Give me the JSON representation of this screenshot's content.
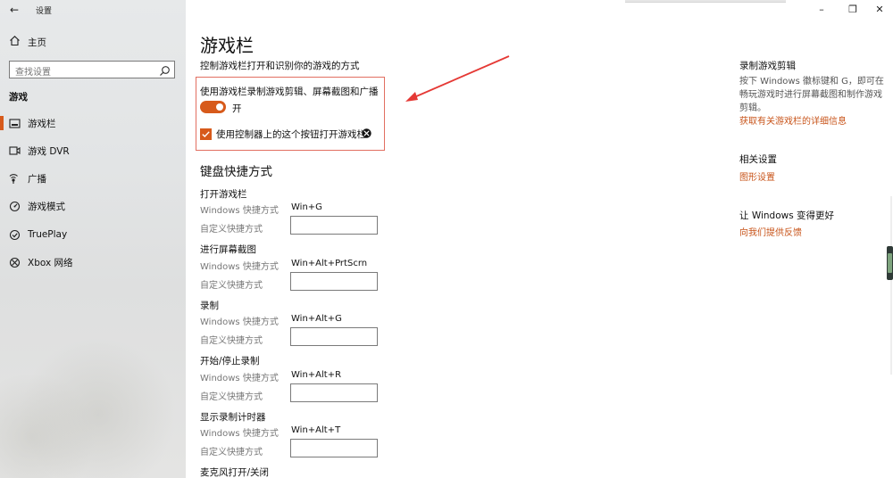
{
  "window": {
    "title": "设置",
    "back_icon": "back-arrow-icon",
    "controls": {
      "minimize": "–",
      "maximize": "❐",
      "close": "✕"
    }
  },
  "sidebar": {
    "home": {
      "label": "主页",
      "icon": "home-icon"
    },
    "search": {
      "placeholder": "查找设置",
      "icon": "search-icon"
    },
    "section": "游戏",
    "items": [
      {
        "label": "游戏栏",
        "icon": "game-bar-icon",
        "selected": true
      },
      {
        "label": "游戏 DVR",
        "icon": "dvr-icon",
        "selected": false
      },
      {
        "label": "广播",
        "icon": "broadcast-icon",
        "selected": false
      },
      {
        "label": "游戏模式",
        "icon": "game-mode-icon",
        "selected": false
      },
      {
        "label": "TruePlay",
        "icon": "trueplay-icon",
        "selected": false
      },
      {
        "label": "Xbox 网络",
        "icon": "xbox-icon",
        "selected": false
      }
    ],
    "accent": "#d75a1b"
  },
  "main": {
    "title": "游戏栏",
    "description": "控制游戏栏打开和识别你的游戏的方式",
    "record_option": {
      "label": "使用游戏栏录制游戏剪辑、屏幕截图和广播",
      "state": "开",
      "on": true
    },
    "controller_option": {
      "label": "使用控制器上的这个按钮打开游戏栏:",
      "checked": true,
      "icon": "xbox-logo-icon"
    },
    "keyboard_title": "键盘快捷方式",
    "windows_shortcut_label": "Windows 快捷方式",
    "custom_shortcut_label": "自定义快捷方式",
    "shortcuts": [
      {
        "action": "打开游戏栏",
        "windows": "Win+G",
        "custom": ""
      },
      {
        "action": "进行屏幕截图",
        "windows": "Win+Alt+PrtScrn",
        "custom": ""
      },
      {
        "action": "录制",
        "windows": "Win+Alt+G",
        "custom": ""
      },
      {
        "action": "开始/停止录制",
        "windows": "Win+Alt+R",
        "custom": ""
      },
      {
        "action": "显示录制计时器",
        "windows": "Win+Alt+T",
        "custom": ""
      },
      {
        "action": "麦克风打开/关闭"
      }
    ]
  },
  "right": {
    "clips": {
      "title": "录制游戏剪辑",
      "body": "按下 Windows 徽标键和 G，即可在畅玩游戏时进行屏幕截图和制作游戏剪辑。",
      "link": "获取有关游戏栏的详细信息"
    },
    "related": {
      "title": "相关设置",
      "link": "图形设置"
    },
    "feedback": {
      "title": "让 Windows 变得更好",
      "link": "向我们提供反馈"
    },
    "link_color": "#c8541a"
  },
  "annotation": {
    "highlight_color": "#e26f61",
    "arrow_color": "#e53935"
  }
}
